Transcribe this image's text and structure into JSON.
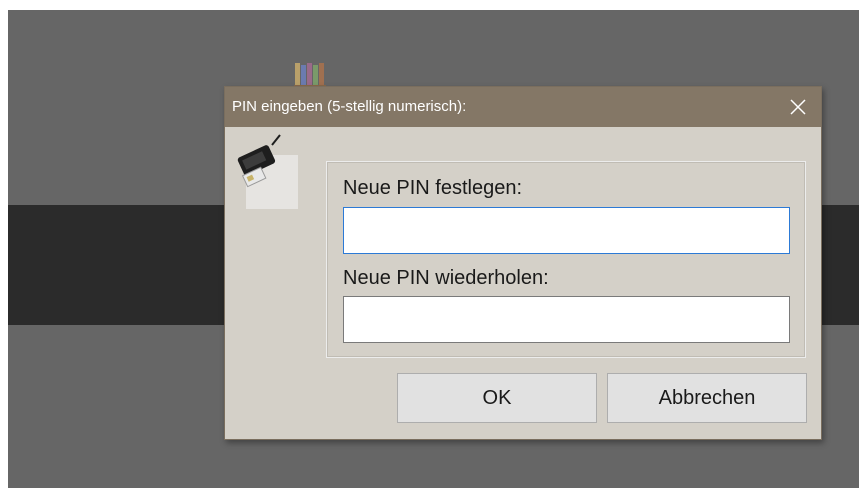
{
  "dialog": {
    "title": "PIN eingeben (5-stellig numerisch):",
    "close_icon": "close-icon",
    "icon": "card-reader-icon",
    "new_pin_label": "Neue PIN festlegen:",
    "new_pin_value": "",
    "repeat_pin_label": "Neue PIN wiederholen:",
    "repeat_pin_value": "",
    "ok_label": "OK",
    "cancel_label": "Abbrechen"
  },
  "background": {
    "tray_icon": "books-icon"
  },
  "colors": {
    "titlebar": "#847766",
    "dialog_bg": "#d4d0c8",
    "focus_border": "#2c7ad6",
    "backdrop": "#666666"
  }
}
